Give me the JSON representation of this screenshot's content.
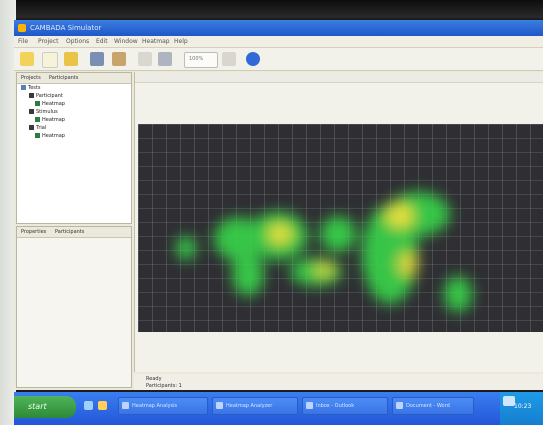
{
  "window": {
    "title": "CAMBADA Simulator",
    "menu": [
      "File",
      "Project",
      "Options",
      "Edit",
      "Window",
      "Heatmap",
      "Help"
    ]
  },
  "toolbar": {
    "zoom_label": "100%",
    "buttons": [
      "open-folder-icon",
      "new-file-icon",
      "save-icon",
      "gallery-icon",
      "delete-icon",
      "copy-icon",
      "zoom-field",
      "grid-icon",
      "globe-icon"
    ]
  },
  "left_panel": {
    "tabs": [
      "Projects",
      "Participants"
    ],
    "tree": [
      "Tests",
      "Participant",
      "Heatmap",
      "Stimulus",
      "Heatmap",
      "Trial",
      "Heatmap"
    ]
  },
  "lower_panel": {
    "tabs": [
      "Properties",
      "Participants"
    ]
  },
  "status": {
    "line1": "Ready",
    "line2": "Participants: 1"
  },
  "taskbar": {
    "start_label": "start",
    "buttons": [
      "Heatmap Analysis",
      "Heatmap Analyzer",
      "Inbox - Outlook",
      "Document - Word"
    ],
    "clock": "10:23"
  },
  "colors": {
    "titlebar": "#1f57c8",
    "canvas_bg": "#2f2f33",
    "heat_green": "#39d24a",
    "heat_yellow": "#f4ee3c"
  }
}
